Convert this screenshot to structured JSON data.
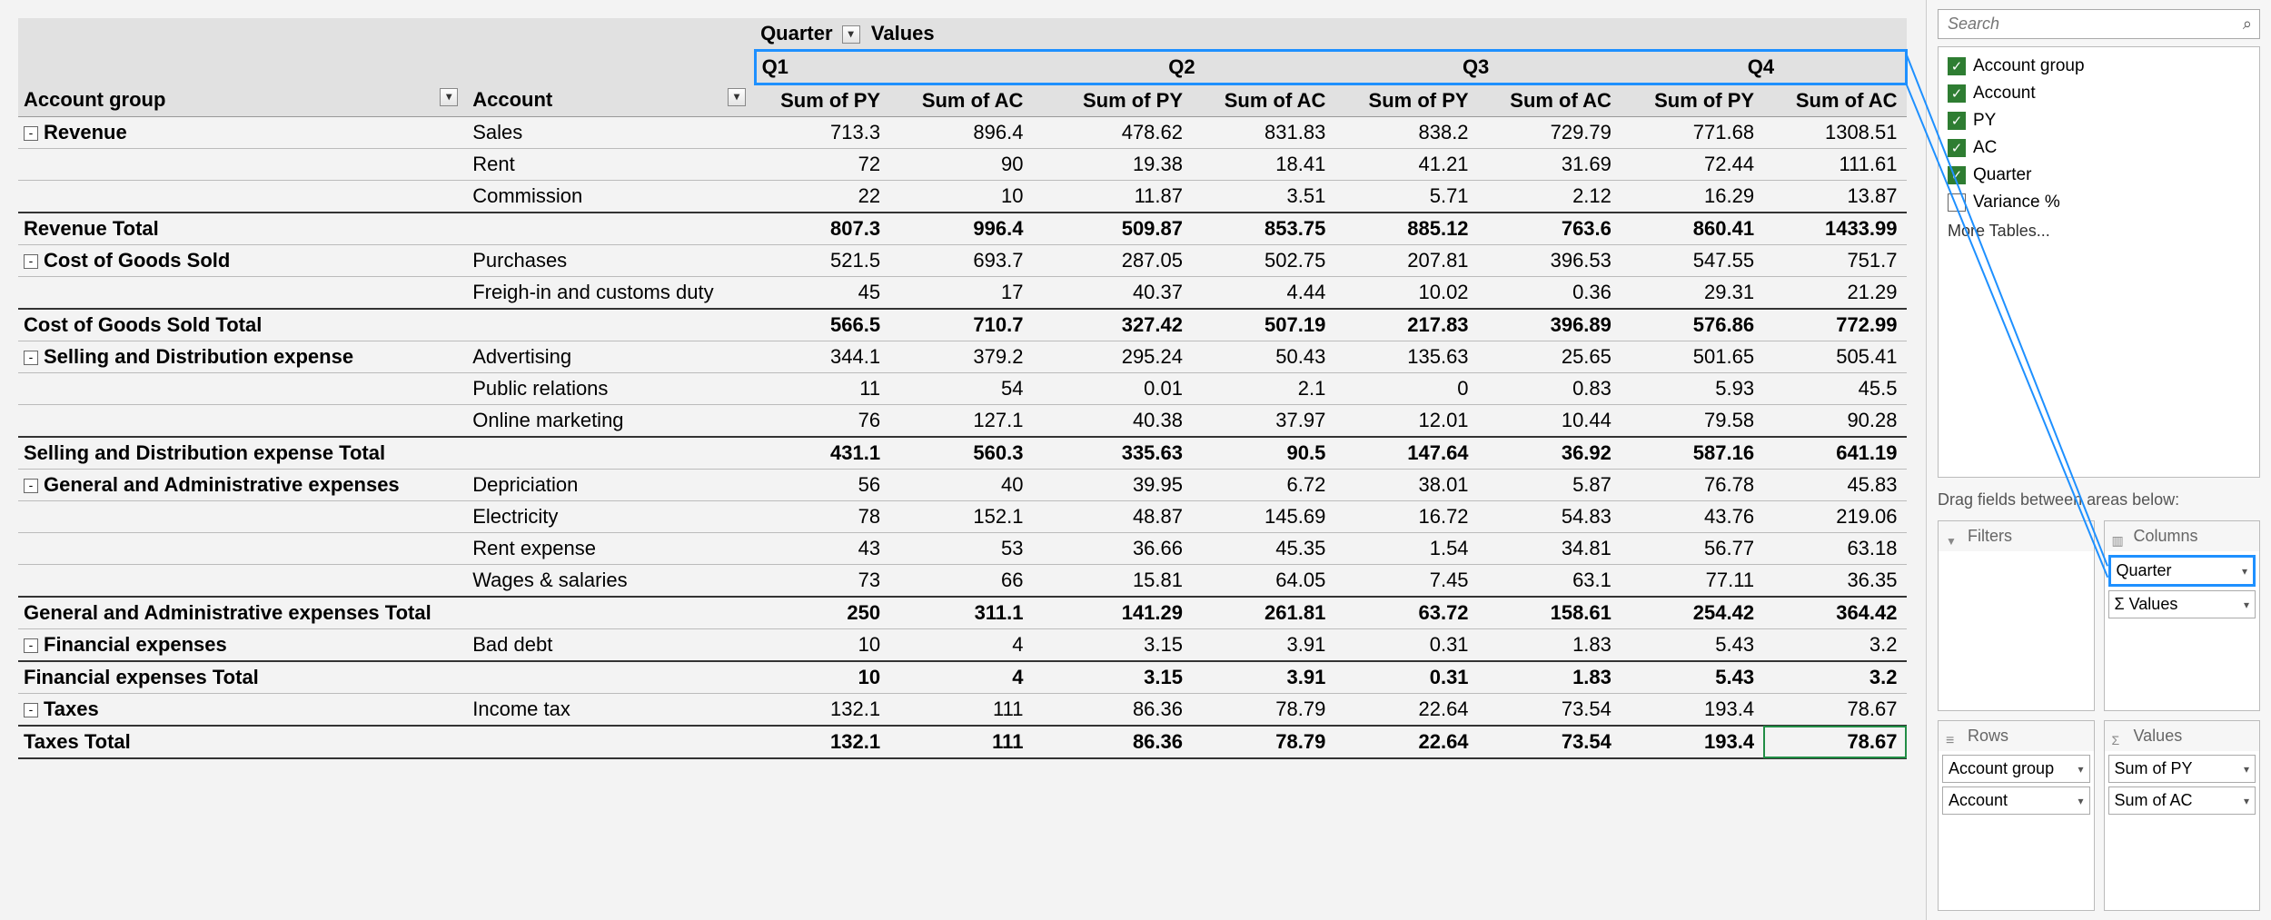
{
  "header": {
    "quarter_label": "Quarter",
    "values_label": "Values",
    "row_field1": "Account group",
    "row_field2": "Account",
    "quarters": [
      "Q1",
      "Q2",
      "Q3",
      "Q4"
    ],
    "measures": [
      "Sum of PY",
      "Sum of AC"
    ]
  },
  "rows": [
    {
      "type": "group",
      "collapsible": true,
      "group": "Revenue",
      "account": "Sales",
      "vals": [
        "713.3",
        "896.4",
        "478.62",
        "831.83",
        "838.2",
        "729.79",
        "771.68",
        "1308.51"
      ]
    },
    {
      "type": "data",
      "group": "",
      "account": "Rent",
      "vals": [
        "72",
        "90",
        "19.38",
        "18.41",
        "41.21",
        "31.69",
        "72.44",
        "111.61"
      ]
    },
    {
      "type": "data",
      "group": "",
      "account": "Commission",
      "vals": [
        "22",
        "10",
        "11.87",
        "3.51",
        "5.71",
        "2.12",
        "16.29",
        "13.87"
      ]
    },
    {
      "type": "total",
      "group": "Revenue Total",
      "account": "",
      "vals": [
        "807.3",
        "996.4",
        "509.87",
        "853.75",
        "885.12",
        "763.6",
        "860.41",
        "1433.99"
      ],
      "topline": true
    },
    {
      "type": "group",
      "collapsible": true,
      "group": "Cost of Goods Sold",
      "account": "Purchases",
      "vals": [
        "521.5",
        "693.7",
        "287.05",
        "502.75",
        "207.81",
        "396.53",
        "547.55",
        "751.7"
      ]
    },
    {
      "type": "data",
      "group": "",
      "account": "Freigh-in and customs duty",
      "vals": [
        "45",
        "17",
        "40.37",
        "4.44",
        "10.02",
        "0.36",
        "29.31",
        "21.29"
      ]
    },
    {
      "type": "total",
      "group": "Cost of Goods Sold Total",
      "account": "",
      "vals": [
        "566.5",
        "710.7",
        "327.42",
        "507.19",
        "217.83",
        "396.89",
        "576.86",
        "772.99"
      ],
      "topline": true
    },
    {
      "type": "group",
      "collapsible": true,
      "group": "Selling and Distribution expense",
      "account": "Advertising",
      "vals": [
        "344.1",
        "379.2",
        "295.24",
        "50.43",
        "135.63",
        "25.65",
        "501.65",
        "505.41"
      ]
    },
    {
      "type": "data",
      "group": "",
      "account": "Public relations",
      "vals": [
        "11",
        "54",
        "0.01",
        "2.1",
        "0",
        "0.83",
        "5.93",
        "45.5"
      ]
    },
    {
      "type": "data",
      "group": "",
      "account": "Online marketing",
      "vals": [
        "76",
        "127.1",
        "40.38",
        "37.97",
        "12.01",
        "10.44",
        "79.58",
        "90.28"
      ]
    },
    {
      "type": "total",
      "group": "Selling and Distribution expense Total",
      "account": "",
      "vals": [
        "431.1",
        "560.3",
        "335.63",
        "90.5",
        "147.64",
        "36.92",
        "587.16",
        "641.19"
      ],
      "topline": true
    },
    {
      "type": "group",
      "collapsible": true,
      "group": "General and Administrative expenses",
      "account": "Depriciation",
      "vals": [
        "56",
        "40",
        "39.95",
        "6.72",
        "38.01",
        "5.87",
        "76.78",
        "45.83"
      ]
    },
    {
      "type": "data",
      "group": "",
      "account": "Electricity",
      "vals": [
        "78",
        "152.1",
        "48.87",
        "145.69",
        "16.72",
        "54.83",
        "43.76",
        "219.06"
      ]
    },
    {
      "type": "data",
      "group": "",
      "account": "Rent expense",
      "vals": [
        "43",
        "53",
        "36.66",
        "45.35",
        "1.54",
        "34.81",
        "56.77",
        "63.18"
      ]
    },
    {
      "type": "data",
      "group": "",
      "account": "Wages & salaries",
      "vals": [
        "73",
        "66",
        "15.81",
        "64.05",
        "7.45",
        "63.1",
        "77.11",
        "36.35"
      ]
    },
    {
      "type": "total",
      "group": "General and Administrative expenses Total",
      "account": "",
      "vals": [
        "250",
        "311.1",
        "141.29",
        "261.81",
        "63.72",
        "158.61",
        "254.42",
        "364.42"
      ],
      "topline": true
    },
    {
      "type": "group",
      "collapsible": true,
      "group": "Financial expenses",
      "account": "Bad debt",
      "vals": [
        "10",
        "4",
        "3.15",
        "3.91",
        "0.31",
        "1.83",
        "5.43",
        "3.2"
      ]
    },
    {
      "type": "total",
      "group": "Financial expenses Total",
      "account": "",
      "vals": [
        "10",
        "4",
        "3.15",
        "3.91",
        "0.31",
        "1.83",
        "5.43",
        "3.2"
      ],
      "topline": true
    },
    {
      "type": "group",
      "collapsible": true,
      "group": "Taxes",
      "account": "Income tax",
      "vals": [
        "132.1",
        "111",
        "86.36",
        "78.79",
        "22.64",
        "73.54",
        "193.4",
        "78.67"
      ]
    },
    {
      "type": "total",
      "group": "Taxes Total",
      "account": "",
      "vals": [
        "132.1",
        "111",
        "86.36",
        "78.79",
        "22.64",
        "73.54",
        "193.4",
        "78.67"
      ],
      "topline": true,
      "last": true,
      "selectedIndex": 7
    }
  ],
  "side": {
    "search_placeholder": "Search",
    "fields": [
      {
        "name": "Account group",
        "checked": true
      },
      {
        "name": "Account",
        "checked": true
      },
      {
        "name": "PY",
        "checked": true
      },
      {
        "name": "AC",
        "checked": true
      },
      {
        "name": "Quarter",
        "checked": true
      },
      {
        "name": "Variance %",
        "checked": false
      }
    ],
    "more_tables": "More Tables...",
    "drag_hint": "Drag fields between areas below:",
    "areas": {
      "filters_label": "Filters",
      "columns_label": "Columns",
      "rows_label": "Rows",
      "values_label": "Values",
      "columns": [
        {
          "label": "Quarter",
          "highlight": true
        },
        {
          "label": "Σ Values",
          "highlight": false
        }
      ],
      "rows": [
        {
          "label": "Account group"
        },
        {
          "label": "Account"
        }
      ],
      "values": [
        {
          "label": "Sum of PY"
        },
        {
          "label": "Sum of AC"
        }
      ]
    }
  }
}
